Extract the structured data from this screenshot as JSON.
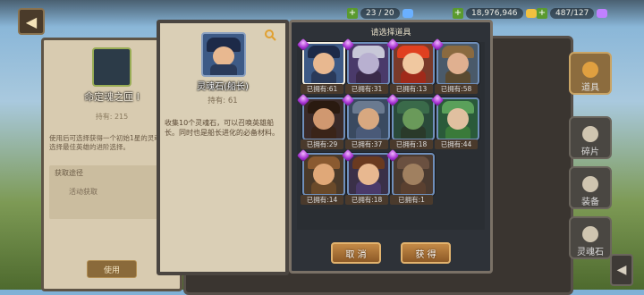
{
  "topbar": {
    "back_icon": "arrow-left-icon",
    "resources": [
      {
        "value": "23 / 20",
        "icon": "stamina-icon",
        "color": "#6ab0ff"
      },
      {
        "value": "18,976,946",
        "icon": "gold-icon",
        "color": "#f0c040"
      },
      {
        "value": "487/127",
        "icon": "gem-icon",
        "color": "#c080ff"
      }
    ]
  },
  "left_card": {
    "title": "命定魂之匣 I",
    "owned_label": "持有: 215",
    "desc": "使用后可选择获得一个初始1星的灵魂石。",
    "desc2": "选择最佳英雄的进阶选择。",
    "section_title": "获取途径",
    "section_item": "活动获取",
    "use_button": "使用"
  },
  "detail_card": {
    "title": "灵魂石(船长)",
    "owned_label": "持有: 61",
    "desc": "收集10个灵魂石，可以召唤英雄船长。同时也是船长进化的必备材料。",
    "search_icon": "magnifier-icon"
  },
  "select_panel": {
    "title": "请选择道具",
    "items": [
      {
        "name": "captain",
        "count": "已拥有:61",
        "selected": true,
        "bg": "#3d5a86",
        "hat": "#1d2a48",
        "face": "#e8b890",
        "body": "#2a3a5a"
      },
      {
        "name": "dark-elf",
        "count": "已拥有:31",
        "selected": false,
        "bg": "#4a3a6a",
        "hat": "#c8c8d8",
        "face": "#b8b0d0",
        "body": "#3a2a4a"
      },
      {
        "name": "fire-girl",
        "count": "已拥有:13",
        "selected": false,
        "bg": "#7a3a2a",
        "hat": "#e04020",
        "face": "#f0c8a0",
        "body": "#a02a1a"
      },
      {
        "name": "engineer",
        "count": "已拥有:58",
        "selected": false,
        "bg": "#4a5a6a",
        "hat": "#8a6a40",
        "face": "#e0b090",
        "body": "#5a4a30"
      },
      {
        "name": "bounty-hunter",
        "count": "已拥有:29",
        "selected": false,
        "bg": "#3a2a28",
        "hat": "#2a1a10",
        "face": "#d09870",
        "body": "#3a2418"
      },
      {
        "name": "dwarf",
        "count": "已拥有:37",
        "selected": false,
        "bg": "#3a4a60",
        "hat": "#6a7a90",
        "face": "#d8a880",
        "body": "#4a5a78"
      },
      {
        "name": "orc-shaman",
        "count": "已拥有:18",
        "selected": false,
        "bg": "#2a4a3a",
        "hat": "#3a6a4a",
        "face": "#6a9a5a",
        "body": "#2a3a2a"
      },
      {
        "name": "dryad",
        "count": "已拥有:44",
        "selected": false,
        "bg": "#2a5a3a",
        "hat": "#5aa05a",
        "face": "#e0c0a0",
        "body": "#3a7a3a"
      },
      {
        "name": "barbarian",
        "count": "已拥有:14",
        "selected": false,
        "bg": "#4a3a2a",
        "hat": "#8a5a30",
        "face": "#e0a878",
        "body": "#6a4a2a"
      },
      {
        "name": "swordsman",
        "count": "已拥有:18",
        "selected": false,
        "bg": "#3a3048",
        "hat": "#6a3a20",
        "face": "#e8b890",
        "body": "#4a3a6a"
      },
      {
        "name": "boar-warrior",
        "count": "已拥有:1",
        "selected": false,
        "bg": "#4a3a30",
        "hat": "#6a5040",
        "face": "#a08060",
        "body": "#5a4030"
      }
    ],
    "cancel_button": "取 消",
    "get_button": "获 得"
  },
  "right_tabs": [
    {
      "label": "道具",
      "active": true
    },
    {
      "label": "碎片",
      "active": false
    },
    {
      "label": "装备",
      "active": false
    },
    {
      "label": "灵魂石",
      "active": false
    }
  ]
}
